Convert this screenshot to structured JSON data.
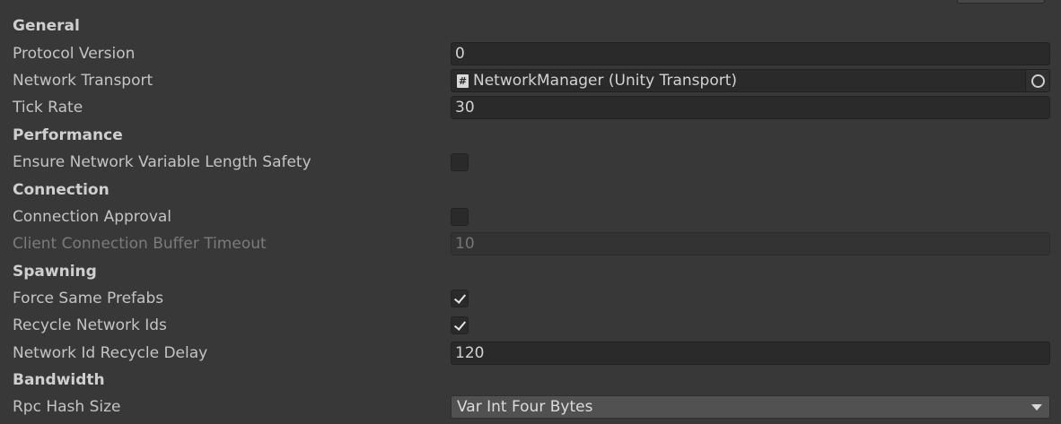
{
  "inspector": {
    "rows": [
      {
        "kind": "header",
        "label": "General"
      },
      {
        "kind": "text",
        "label": "Protocol Version",
        "value": "0"
      },
      {
        "kind": "object",
        "label": "Network Transport",
        "value": "NetworkManager (Unity Transport)",
        "icon": "script-icon"
      },
      {
        "kind": "text",
        "label": "Tick Rate",
        "value": "30"
      },
      {
        "kind": "header",
        "label": "Performance"
      },
      {
        "kind": "checkbox",
        "label": "Ensure Network Variable Length Safety",
        "checked": false
      },
      {
        "kind": "header",
        "label": "Connection"
      },
      {
        "kind": "checkbox",
        "label": "Connection Approval",
        "checked": false
      },
      {
        "kind": "text",
        "label": "Client Connection Buffer Timeout",
        "value": "10",
        "disabled": true
      },
      {
        "kind": "header",
        "label": "Spawning"
      },
      {
        "kind": "checkbox",
        "label": "Force Same Prefabs",
        "checked": true
      },
      {
        "kind": "checkbox",
        "label": "Recycle Network Ids",
        "checked": true
      },
      {
        "kind": "text",
        "label": "Network Id Recycle Delay",
        "value": "120"
      },
      {
        "kind": "header",
        "label": "Bandwidth"
      },
      {
        "kind": "dropdown",
        "label": "Rpc Hash Size",
        "value": "Var Int Four Bytes"
      }
    ]
  },
  "colors": {
    "background": "#383838",
    "field": "#2a2a2a",
    "dropdown": "#515151",
    "text": "#c4c4c4"
  }
}
